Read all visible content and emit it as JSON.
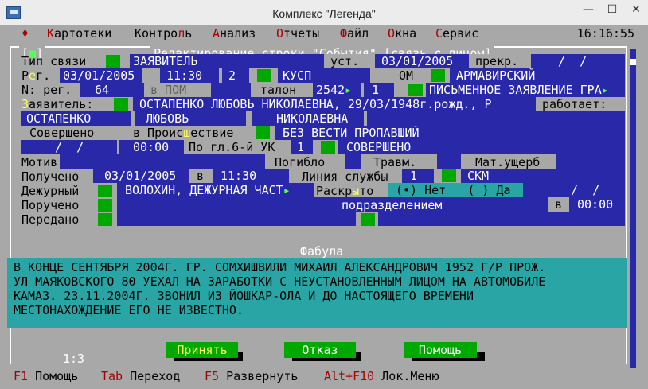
{
  "window": {
    "title": "Комплекс \"Легенда\"",
    "min": "—",
    "max": "☐",
    "close": "✕"
  },
  "menu": {
    "items": [
      {
        "hk": "К",
        "rest": "артотеки"
      },
      {
        "pre": "Контро",
        "hk": "л",
        "rest": "ь"
      },
      {
        "hk": "А",
        "rest": "нализ"
      },
      {
        "hk": "О",
        "rest": "тчеты"
      },
      {
        "hk": "Ф",
        "rest": "айл"
      },
      {
        "hk": "О",
        "rest": "кна"
      },
      {
        "hk": "С",
        "rest": "ервис"
      }
    ],
    "clock": "16:16:55",
    "diamond": "♦"
  },
  "dialog": {
    "close": "■",
    "title": "Редактирование строки \"События\" [связь с лицом]",
    "row1": {
      "label": "Тип связи",
      "value": "ЗАЯВИТЕЛЬ",
      "ust_label": "уст.",
      "ust_date": "03/01/2005",
      "prekr_label": "прекр.",
      "prekr_date": "  /  /"
    },
    "row2": {
      "label_pre": "Р",
      "label_hk": "е",
      "label_post": "г.",
      "date": "03/01/2005",
      "time": "11:30",
      "num": "2",
      "kusp": "КУСП",
      "om": "ОМ",
      "district": "АРМАВИРСКИЙ"
    },
    "row3": {
      "label": "N: рег.",
      "reg_num": "64",
      "v_pom": "в ПОМ",
      "talon_label": "талон",
      "talon": "2542",
      "count": "1",
      "statement": "ПИСЬМЕННОЕ ЗАЯВЛЕНИЕ ГРА"
    },
    "row4": {
      "label_hk": "З",
      "label_rest": "аявитель:",
      "person": "ОСТАПЕНКО ЛЮБОВЬ НИКОЛАЕВНА, 29/03/1948г.рожд., Р",
      "works_label": "работает:"
    },
    "row5": {
      "surname": "ОСТАПЕНКО",
      "name": "ЛЮБОВЬ",
      "patronymic": "НИКОЛАЕВНА"
    },
    "row6": {
      "label": "Совершено",
      "incident_pre": "в Проис",
      "incident_hk": "ш",
      "incident_post": "ествие",
      "incident": "БЕЗ ВЕСТИ ПРОПАВШИЙ"
    },
    "row7": {
      "date": "  /  /",
      "time": "00:00",
      "article_label": "По гл.6-й УК",
      "article_num": "1",
      "status": "СОВЕРШЕНО"
    },
    "row8": {
      "motive": "Мотив",
      "died": "Погибло",
      "injured": "Травм.",
      "damage": "Мат.ущерб"
    },
    "row9": {
      "label": "Получено",
      "date": "03/01/2005",
      "v": "в",
      "time": "11:30",
      "service_label": "Линия службы",
      "service_num": "1",
      "service": "СКМ"
    },
    "row10": {
      "label": "Дежурный",
      "officer": "ВОЛОХИН, ДЕЖУРНАЯ ЧАСТ",
      "solved_pre": "Раскр",
      "solved_hk": "ы",
      "solved_post": "то",
      "radio_no": "(•) Нет",
      "radio_yes": "( ) Да",
      "solved_date": "  /  /"
    },
    "row11": {
      "label": "Поручено",
      "unit_label": "подразделением",
      "v": "в",
      "time": "00:00"
    },
    "row12": {
      "label": "Передано"
    },
    "fabula_title": "Фабула",
    "fabula_lines": [
      "В КОНЦЕ СЕНТЯБРЯ 2004Г. ГР. СОМХИШВИЛИ МИХАИЛ АЛЕКСАНДРОВИЧ 1952 Г/Р ПРОЖ.",
      "УЛ МАЯКОВСКОГО 80 УЕХАЛ НА ЗАРАБОТКИ С НЕУСТАНОВЛЕННЫМ ЛИЦОМ НА АВТОМОБИЛЕ",
      "КАМАЗ. 23.11.2004Г. ЗВОНИЛ ИЗ ЙОШКАР-ОЛА И ДО НАСТОЯЩЕГО ВРЕМЕНИ",
      "МЕСТОНАХОЖДЕНИЕ ЕГО НЕ ИЗВЕСТНО."
    ],
    "buttons": {
      "accept": "Принять",
      "reject": "Отказ",
      "help": "Помощь"
    },
    "page_indicator": "1:3"
  },
  "status": [
    {
      "key": "F1",
      "label": "Помощь"
    },
    {
      "key": "Tab",
      "label": "Переход"
    },
    {
      "key": "F5",
      "label": "Развернуть"
    },
    {
      "key": "Alt+F10",
      "label": "Лок.Меню"
    }
  ],
  "colors": {
    "console_gray": "#a8a8a8",
    "field_blue": "#2828a8",
    "accent_green": "#00a800",
    "fabula_cyan": "#2aa5a5",
    "hotkey_red": "#a80000"
  }
}
